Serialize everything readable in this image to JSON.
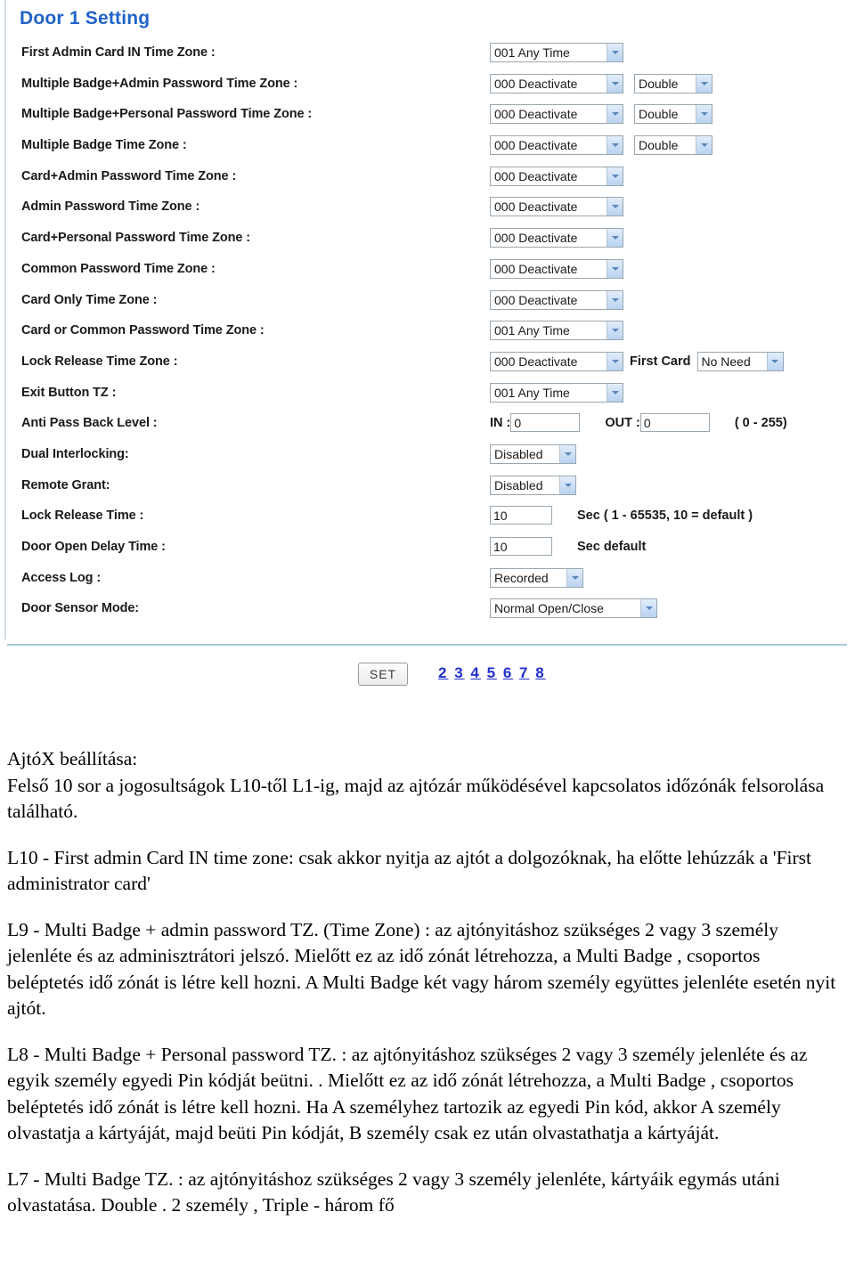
{
  "ui": {
    "title": "Door 1 Setting",
    "rows": [
      {
        "label": "First Admin Card IN Time Zone :",
        "controls": [
          {
            "kind": "select",
            "width": "w-tz",
            "value": "001 Any Time",
            "name": "first-admin-card-in-time-zone-select"
          }
        ]
      },
      {
        "label": "Multiple Badge+Admin Password Time Zone :",
        "controls": [
          {
            "kind": "select",
            "width": "w-tz",
            "value": "000 Deactivate",
            "name": "multiple-badge-admin-password-time-zone-select"
          },
          {
            "kind": "select",
            "width": "w-dbl",
            "value": "Double",
            "name": "multiple-badge-admin-password-count-select",
            "gap": "gap-m"
          }
        ]
      },
      {
        "label": "Multiple Badge+Personal Password Time Zone :",
        "controls": [
          {
            "kind": "select",
            "width": "w-tz",
            "value": "000 Deactivate",
            "name": "multiple-badge-personal-password-time-zone-select"
          },
          {
            "kind": "select",
            "width": "w-dbl",
            "value": "Double",
            "name": "multiple-badge-personal-password-count-select",
            "gap": "gap-m"
          }
        ]
      },
      {
        "label": "Multiple Badge Time Zone :",
        "controls": [
          {
            "kind": "select",
            "width": "w-tz",
            "value": "000 Deactivate",
            "name": "multiple-badge-time-zone-select"
          },
          {
            "kind": "select",
            "width": "w-dbl",
            "value": "Double",
            "name": "multiple-badge-count-select",
            "gap": "gap-m"
          }
        ]
      },
      {
        "label": "Card+Admin Password Time Zone :",
        "controls": [
          {
            "kind": "select",
            "width": "w-tz",
            "value": "000 Deactivate",
            "name": "card-admin-password-time-zone-select"
          }
        ]
      },
      {
        "label": "Admin Password Time Zone :",
        "controls": [
          {
            "kind": "select",
            "width": "w-tz",
            "value": "000 Deactivate",
            "name": "admin-password-time-zone-select"
          }
        ]
      },
      {
        "label": "Card+Personal Password Time Zone :",
        "controls": [
          {
            "kind": "select",
            "width": "w-tz",
            "value": "000 Deactivate",
            "name": "card-personal-password-time-zone-select"
          }
        ]
      },
      {
        "label": "Common Password Time Zone :",
        "controls": [
          {
            "kind": "select",
            "width": "w-tz",
            "value": "000 Deactivate",
            "name": "common-password-time-zone-select"
          }
        ]
      },
      {
        "label": "Card Only Time Zone :",
        "controls": [
          {
            "kind": "select",
            "width": "w-tz",
            "value": "000 Deactivate",
            "name": "card-only-time-zone-select"
          }
        ]
      },
      {
        "label": "Card or Common Password Time Zone :",
        "controls": [
          {
            "kind": "select",
            "width": "w-tz",
            "value": "001 Any Time",
            "name": "card-or-common-password-time-zone-select"
          }
        ]
      },
      {
        "label": "Lock Release Time Zone :",
        "controls": [
          {
            "kind": "select",
            "width": "w-tz",
            "value": "000 Deactivate",
            "name": "lock-release-time-zone-select"
          },
          {
            "kind": "text-label",
            "value": "First Card",
            "name": "first-card-label",
            "gap": "gap-s"
          },
          {
            "kind": "select",
            "width": "w-need",
            "value": "No Need",
            "name": "first-card-select",
            "gap": "gap-s"
          }
        ]
      },
      {
        "label": "Exit Button TZ :",
        "controls": [
          {
            "kind": "select",
            "width": "w-tz",
            "value": "001 Any Time",
            "name": "exit-button-time-zone-select"
          }
        ]
      },
      {
        "label": "Anti Pass Back Level :",
        "controls": [
          {
            "kind": "text-label",
            "value": "IN :",
            "name": "anti-pass-back-in-label"
          },
          {
            "kind": "input",
            "width": "w-apb",
            "value": "0",
            "name": "anti-pass-back-in-input"
          },
          {
            "kind": "text-label",
            "value": "OUT :",
            "name": "anti-pass-back-out-label",
            "gap": "gap-l"
          },
          {
            "kind": "input",
            "width": "w-apb",
            "value": "0",
            "name": "anti-pass-back-out-input"
          },
          {
            "kind": "text-label",
            "value": "( 0 - 255)",
            "name": "anti-pass-back-range-hint",
            "gap": "gap-l"
          }
        ]
      },
      {
        "label": "Dual Interlocking:",
        "controls": [
          {
            "kind": "select",
            "width": "w-dis",
            "value": "Disabled",
            "name": "dual-interlocking-select"
          }
        ]
      },
      {
        "label": "Remote Grant:",
        "controls": [
          {
            "kind": "select",
            "width": "w-dis",
            "value": "Disabled",
            "name": "remote-grant-select"
          }
        ]
      },
      {
        "label": "Lock Release Time  :",
        "controls": [
          {
            "kind": "input",
            "width": "w-sec",
            "value": "10",
            "name": "lock-release-time-input"
          },
          {
            "kind": "text-label",
            "value": "Sec ( 1 - 65535, 10 = default )",
            "name": "lock-release-time-hint",
            "gap": "gap-l"
          }
        ]
      },
      {
        "label": "Door Open Delay Time  :",
        "controls": [
          {
            "kind": "input",
            "width": "w-sec",
            "value": "10",
            "name": "door-open-delay-time-input"
          },
          {
            "kind": "text-label",
            "value": "Sec default",
            "name": "door-open-delay-time-hint",
            "gap": "gap-l"
          }
        ]
      },
      {
        "label": "Access Log :",
        "controls": [
          {
            "kind": "select",
            "width": "w-rec",
            "value": "Recorded",
            "name": "access-log-select"
          }
        ]
      },
      {
        "label": "Door Sensor Mode:",
        "controls": [
          {
            "kind": "select",
            "width": "w-dsm",
            "value": "Normal Open/Close",
            "name": "door-sensor-mode-select"
          }
        ]
      }
    ],
    "set_button": "SET",
    "pager": [
      "2",
      "3",
      "4",
      "5",
      "6",
      "7",
      "8"
    ],
    "colors": {
      "title": "#1f63c8",
      "link": "#2130c8",
      "divider": "#a9c8d8",
      "select_arrow": "#b9d3f0"
    }
  },
  "doc": {
    "blocks": [
      "AjtóX beállítása:",
      "Felső 10 sor a jogosultságok L10-től L1-ig, majd az ajtózár működésével kapcsolatos időzónák felsorolása található.",
      "L10 - First admin Card IN time zone: csak akkor nyitja az ajtót a dolgozóknak, ha előtte lehúzzák a 'First administrator card'",
      "L9 - Multi Badge + admin password TZ. (Time Zone) :  az ajtónyitáshoz szükséges 2 vagy 3 személy jelenléte és az adminisztrátori jelszó. Mielőtt ez az idő zónát létrehozza, a Multi Badge , csoportos beléptetés idő zónát is létre kell hozni. A Multi Badge két vagy három személy együttes jelenléte esetén nyit ajtót.",
      "L8 - Multi Badge + Personal password TZ. :  az ajtónyitáshoz szükséges 2 vagy 3 személy jelenléte és az egyik személy egyedi  Pin kódját beütni. . Mielőtt ez az idő zónát létrehozza, a Multi Badge , csoportos beléptetés idő zónát is létre kell hozni. Ha A személyhez tartozik az egyedi Pin kód, akkor A személy olvastatja  a kártyáját, majd beüti Pin kódját, B személy csak ez után olvastathatja a kártyáját.",
      "L7 - Multi Badge TZ. :  az ajtónyitáshoz szükséges 2 vagy 3 személy jelenléte, kártyáik egymás utáni olvastatása. Double . 2 személy , Triple - három fő"
    ]
  }
}
